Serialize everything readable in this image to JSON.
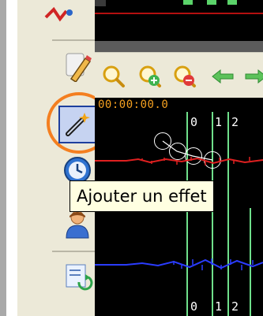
{
  "toolbar": {
    "tools": [
      {
        "name": "effects-chain-icon"
      },
      {
        "name": "edit-pencil-icon"
      },
      {
        "name": "add-effect-wand-icon",
        "active": true
      },
      {
        "name": "timer-clock-icon"
      },
      {
        "name": "user-icon"
      },
      {
        "name": "refresh-list-icon"
      }
    ]
  },
  "tooltip": {
    "text": "Ajouter un effet"
  },
  "timeline": {
    "timecode": "00:00:00.0",
    "markers_top": [
      "0",
      "1",
      "2"
    ],
    "markers_bottom": [
      "0",
      "1",
      "2"
    ]
  },
  "zoom_toolbar": {
    "buttons": [
      "zoom-icon",
      "zoom-in-icon",
      "zoom-out-icon",
      "arrow-left-icon",
      "arrow-right-icon"
    ]
  },
  "colors": {
    "track_red": "#e02020",
    "track_blue": "#2a3cff",
    "marker_green": "#6fe08b",
    "timecode_orange": "#f4a020",
    "highlight_orange": "#f47f20",
    "tooltip_bg": "#ffffe1"
  }
}
